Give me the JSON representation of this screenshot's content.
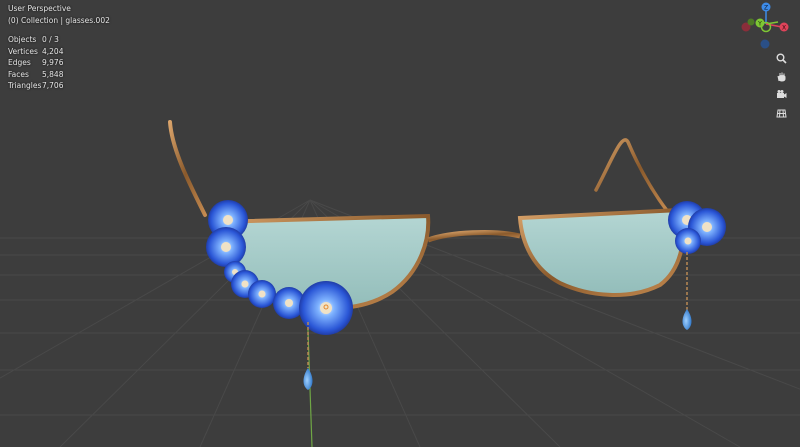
{
  "viewport": {
    "perspective_label": "User Perspective",
    "collection_label": "(0) Collection | glasses.002"
  },
  "stats": [
    {
      "label": "Objects",
      "value": "0 / 3"
    },
    {
      "label": "Vertices",
      "value": "4,204"
    },
    {
      "label": "Edges",
      "value": "9,976"
    },
    {
      "label": "Faces",
      "value": "5,848"
    },
    {
      "label": "Triangles",
      "value": "7,706"
    }
  ],
  "gizmo": {
    "z_label": "Z",
    "y_label": "Y",
    "x_label": "X",
    "colors": {
      "x": "#e0435a",
      "y": "#7ec734",
      "z": "#3d8be8"
    }
  },
  "nav_buttons": [
    {
      "name": "zoom-icon"
    },
    {
      "name": "hand-pan-icon"
    },
    {
      "name": "camera-icon"
    },
    {
      "name": "grid-icon"
    }
  ],
  "colors": {
    "background": "#3d3d3d",
    "grid_line": "#4a4a4a",
    "frame_gold": "#a8743d",
    "lens": "#a9cdca",
    "flower_blue": "#2e5fd0",
    "y_axis": "#6fa645"
  }
}
